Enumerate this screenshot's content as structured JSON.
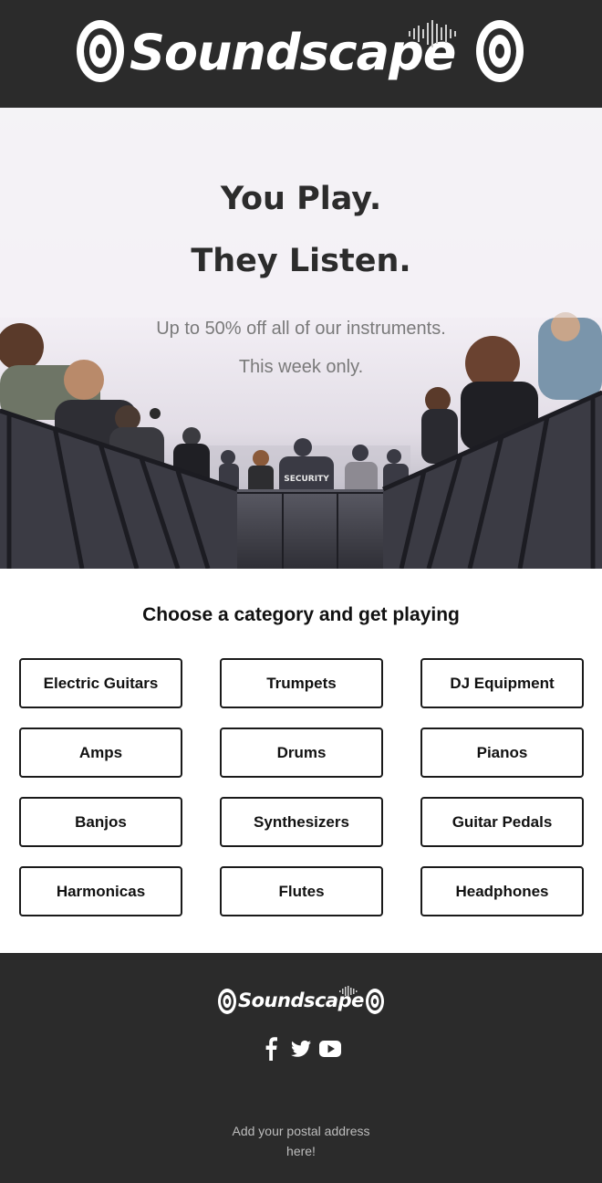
{
  "header": {
    "brand": "Soundscape"
  },
  "hero": {
    "title_line1": "You Play.",
    "title_line2": "They Listen.",
    "subtitle_line1": "Up to 50% off all of our instruments.",
    "subtitle_line2": "This week only.",
    "image_description_icon": "concert-crowd-photo",
    "security_label": "SECURITY"
  },
  "categories": {
    "heading": "Choose a category and get playing",
    "items": [
      {
        "label": "Electric Guitars"
      },
      {
        "label": "Trumpets"
      },
      {
        "label": "DJ Equipment"
      },
      {
        "label": "Amps"
      },
      {
        "label": "Drums"
      },
      {
        "label": "Pianos"
      },
      {
        "label": "Banjos"
      },
      {
        "label": "Synthesizers"
      },
      {
        "label": "Guitar Pedals"
      },
      {
        "label": "Harmonicas"
      },
      {
        "label": "Flutes"
      },
      {
        "label": "Headphones"
      }
    ]
  },
  "footer": {
    "brand": "Soundscape",
    "social_icons": [
      "facebook-icon",
      "twitter-icon",
      "youtube-icon"
    ],
    "address_line1": "Add your postal address",
    "address_line2": "here!"
  },
  "colors": {
    "dark_bg": "#2b2b2b",
    "text_dark": "#2c2c2c",
    "text_muted": "#7a7a7a",
    "button_border": "#1a1a1a"
  }
}
